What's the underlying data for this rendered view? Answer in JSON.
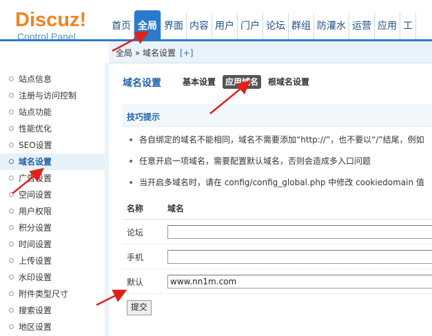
{
  "logo": {
    "brand": "Discuz!",
    "sub": "Control Panel"
  },
  "topnav": [
    {
      "label": "首页",
      "active": false
    },
    {
      "label": "全局",
      "active": true
    },
    {
      "label": "界面",
      "active": false
    },
    {
      "label": "内容",
      "active": false
    },
    {
      "label": "用户",
      "active": false
    },
    {
      "label": "门户",
      "active": false
    },
    {
      "label": "论坛",
      "active": false
    },
    {
      "label": "群组",
      "active": false
    },
    {
      "label": "防灌水",
      "active": false
    },
    {
      "label": "运营",
      "active": false
    },
    {
      "label": "应用",
      "active": false
    },
    {
      "label": "工",
      "active": false
    }
  ],
  "breadcrumb": {
    "path": "全局 » 域名设置",
    "plus": "[+]"
  },
  "sidebar": [
    {
      "label": "站点信息"
    },
    {
      "label": "注册与访问控制"
    },
    {
      "label": "站点功能"
    },
    {
      "label": "性能优化"
    },
    {
      "label": "SEO设置"
    },
    {
      "label": "域名设置",
      "active": true
    },
    {
      "label": "广告设置"
    },
    {
      "label": "空间设置"
    },
    {
      "label": "用户权限"
    },
    {
      "label": "积分设置"
    },
    {
      "label": "时间设置"
    },
    {
      "label": "上传设置"
    },
    {
      "label": "水印设置"
    },
    {
      "label": "附件类型尺寸"
    },
    {
      "label": "搜索设置"
    },
    {
      "label": "地区设置"
    }
  ],
  "main": {
    "title": "域名设置",
    "subtabs": [
      {
        "label": "基本设置",
        "active": false
      },
      {
        "label": "应用域名",
        "active": true
      },
      {
        "label": "根域名设置",
        "active": false
      }
    ],
    "tips_heading": "技巧提示",
    "tips": [
      "各自绑定的域名不能相同，域名不需要添加“http://”，也不要以“/”结尾，例如",
      "任意开启一项域名，需要配置默认域名，否则会造成多入口问题",
      "当开启多域名时，请在 config/config_global.php 中修改 cookiedomain 值"
    ],
    "table": {
      "col_name": "名称",
      "col_domain": "域名",
      "rows": [
        {
          "label": "论坛",
          "value": ""
        },
        {
          "label": "手机",
          "value": ""
        },
        {
          "label": "默认",
          "value": "www.nn1m.com"
        }
      ]
    },
    "submit_label": "提交"
  },
  "colors": {
    "accent": "#2b7acb",
    "logo_orange": "#f5821f",
    "arrow_red": "#e0211b"
  }
}
